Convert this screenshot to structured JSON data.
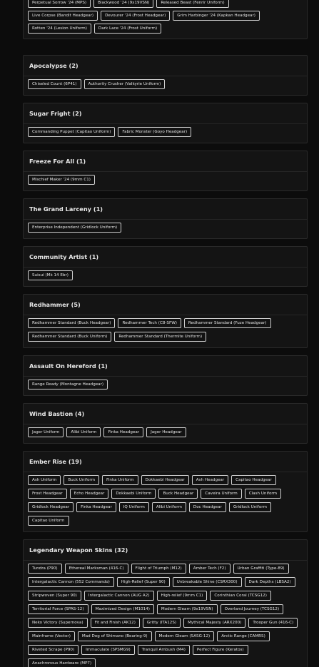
{
  "sections": [
    {
      "id": "top",
      "title": "",
      "chips": [
        "Perpetual Sorrow '24 (MPS)",
        "Blackwood '24 (9x19VSN)",
        "Released Beast (Fenrir Uniform)",
        "Live Corpse (Bandit Headgear)",
        "Devourer '24 (Frost Headgear)",
        "Grim Harbinger '24 (Kapkan Headgear)",
        "Rotten '24 (Lesion Uniform)",
        "Dark Lace '24 (Frost Uniform)"
      ]
    },
    {
      "id": "apocalypse",
      "title": "Apocalypse (2)",
      "chips": [
        "Chiseled Count (6P41)",
        "Authority Crusher (Valkyrie Uniform)"
      ]
    },
    {
      "id": "sugar-fright",
      "title": "Sugar Fright (2)",
      "chips": [
        "Commanding Puppet (Capitao Uniform)",
        "Fabric Monster (Goyo Headgear)"
      ]
    },
    {
      "id": "freeze-for-all",
      "title": "Freeze For All (1)",
      "chips": [
        "Mischief Maker '24 (9mm C1)"
      ]
    },
    {
      "id": "grand-larceny",
      "title": "The Grand Larceny (1)",
      "chips": [
        "Enterprise Independent (Gridlock Uniform)"
      ]
    },
    {
      "id": "community-artist",
      "title": "Community Artist (1)",
      "chips": [
        "Suisui (Mk 14 Ebr)"
      ]
    },
    {
      "id": "redhammer",
      "title": "Redhammer (5)",
      "chips": [
        "Redhammer Standard (Buck Headgear)",
        "Redhammer Tech (C8-SFW)",
        "Redhammer Standard (Fuze Headgear)",
        "Redhammer Standard (Buck Uniform)",
        "Redhammer Standard (Thermite Uniform)"
      ]
    },
    {
      "id": "assault-on-hereford",
      "title": "Assault On Hereford (1)",
      "chips": [
        "Range Ready (Montagne Headgear)"
      ]
    },
    {
      "id": "wind-bastion",
      "title": "Wind Bastion (4)",
      "chips": [
        "Jager Uniform",
        "Alibi Uniform",
        "Finka Headgear",
        "Jager Headgear"
      ]
    },
    {
      "id": "ember-rise",
      "title": "Ember Rise (19)",
      "chips": [
        "Ash Uniform",
        "Buck Uniform",
        "Finka Uniform",
        "Dokkaebi Headgear",
        "Ash Headgear",
        "Capitao Headgear",
        "Frost Headgear",
        "Echo Headgear",
        "Dokkaebi Uniform",
        "Buck Headgear",
        "Caveira Uniform",
        "Clash Uniform",
        "Gridlock Headgear",
        "Finka Headgear",
        "IQ Uniform",
        "Alibi Uniform",
        "Doc Headgear",
        "Gridlock Uniform",
        "Capitao Uniform"
      ]
    },
    {
      "id": "legendary-weapon-skins",
      "title": "Legendary Weapon Skins (32)",
      "chips": [
        "Tundra (P90)",
        "Ethereal Marksman (416-C)",
        "Flight of Triumph (M12)",
        "Amber Tech (F2)",
        "Urban Graffiti (Type-89)",
        "Intergalactic Cannon (552 Commando)",
        "High-Relief (Super 90)",
        "Unbreakable Shine (CSRX300)",
        "Dark Depths (LBSA2)",
        "Stripwoven (Super 90)",
        "Intergalactic Cannon (AUG A2)",
        "High-relief (9mm C1)",
        "Corinthian Coral (TCSG12)",
        "Territorial Force (SPAS-12)",
        "Maximized Design (M1014)",
        "Modern Gleam (9x19VSN)",
        "Overland Journey (TCSG12)",
        "Neko Victory (Supernova)",
        "Fit and Finish (AK12)",
        "Gritty (ITA12S)",
        "Mythical Majesty (ARX200)",
        "Trooper Gun (416-C)",
        "Mainframe (Vector)",
        "Mad Dog of Shimano (Bearing-9)",
        "Modern Gleam (SASG-12)",
        "Arctic Range (CAMRS)",
        "Riveted Scrape (P90)",
        "Immaculate (SPSMG9)",
        "Tranquil Ambush (M4)",
        "Perfect Figure (Keratos)",
        "Anachronous Hardware (MP7)"
      ]
    }
  ]
}
